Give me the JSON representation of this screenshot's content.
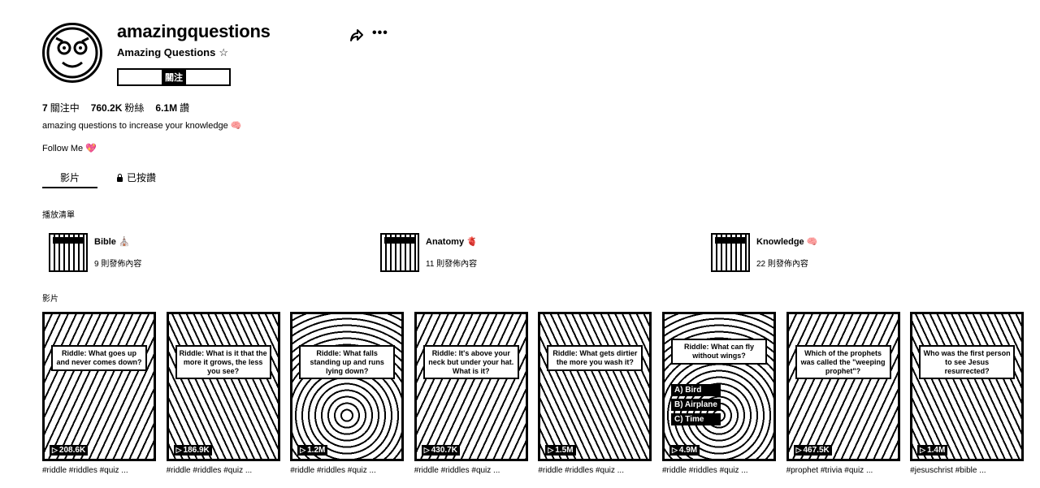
{
  "profile": {
    "username": "amazingquestions",
    "display_name": "Amazing Questions",
    "star": "☆",
    "follow_label": "關注",
    "more_label": "•••",
    "stats": [
      {
        "value": "7",
        "label": "關注中"
      },
      {
        "value": "760.2K",
        "label": "粉絲"
      },
      {
        "value": "6.1M",
        "label": "讚"
      }
    ],
    "bio": "amazing questions to increase your knowledge 🧠",
    "link": "Follow Me 💖"
  },
  "tabs": {
    "videos": "影片",
    "liked": "已按讚"
  },
  "playlists": {
    "label": "播放清單",
    "items": [
      {
        "title": "Bible ⛪",
        "count": "9 則發佈內容"
      },
      {
        "title": "Anatomy 🫀",
        "count": "11 則發佈內容"
      },
      {
        "title": "Knowledge 🧠",
        "count": "22 則發佈內容"
      }
    ]
  },
  "videos": {
    "label": "影片",
    "items": [
      {
        "question": "Riddle: What goes up and never comes down?",
        "views": "208.6K",
        "caption": "#riddle #riddles #quiz ..."
      },
      {
        "question": "Riddle: What is it that the more it grows, the less you see?",
        "views": "186.9K",
        "caption": "#riddle #riddles #quiz ..."
      },
      {
        "question": "Riddle: What falls standing up and runs lying down?",
        "views": "1.2M",
        "caption": "#riddle #riddles #quiz ..."
      },
      {
        "question": "Riddle: It's above your neck but under your hat. What is it?",
        "views": "430.7K",
        "caption": "#riddle #riddles #quiz ..."
      },
      {
        "question": "Riddle: What gets dirtier the more you wash it?",
        "views": "1.5M",
        "caption": "#riddle #riddles #quiz ..."
      },
      {
        "question": "Riddle: What can fly without wings?",
        "views": "4.9M",
        "caption": "#riddle #riddles #quiz ...",
        "options": [
          "A) Bird",
          "B) Airplane",
          "C) Time"
        ]
      },
      {
        "question": "Which of the prophets was called the \"weeping prophet\"?",
        "views": "467.5K",
        "caption": "#prophet #trivia #quiz ..."
      },
      {
        "question": "Who was the first person to see Jesus resurrected?",
        "views": "1.4M",
        "caption": "#jesuschrist #bible ..."
      }
    ]
  }
}
